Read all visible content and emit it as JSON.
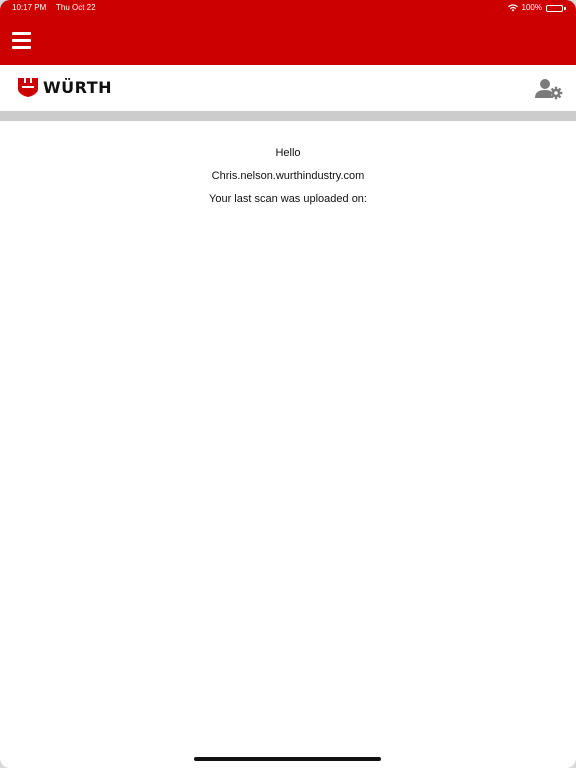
{
  "status_bar": {
    "time": "10:17 PM",
    "date": "Thu Oct 22",
    "battery": "100%"
  },
  "nav": {
    "menu_icon": "hamburger-icon",
    "background_color": "#cc0000"
  },
  "brand": {
    "logo_text": "WÜRTH",
    "logo_color": "#cc0000",
    "settings_icon": "user-settings-icon"
  },
  "greeting": {
    "hello": "Hello",
    "email": "Chris.nelson.wurthindustry.com",
    "last_scan": "Your last scan was uploaded on:"
  }
}
